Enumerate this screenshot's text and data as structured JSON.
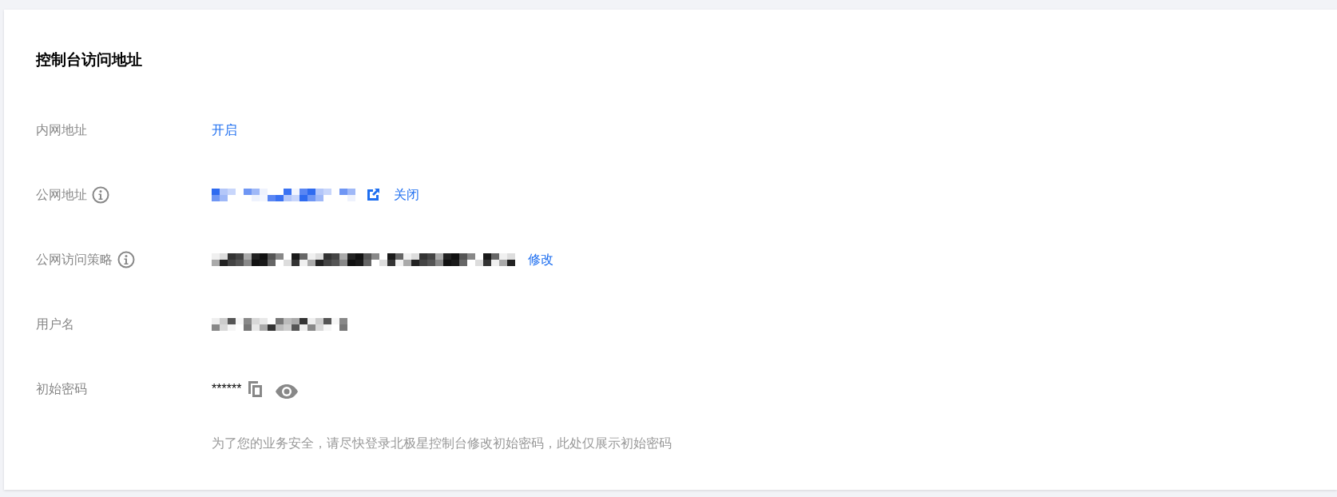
{
  "title": "控制台访问地址",
  "rows": [
    {
      "label": "内网地址",
      "info": false,
      "actions": [
        "开启"
      ]
    },
    {
      "label": "公网地址",
      "info": true,
      "redacted": true,
      "external_link": true,
      "actions": [
        "关闭"
      ]
    },
    {
      "label": "公网访问策略",
      "info": true,
      "redacted": true,
      "actions": [
        "修改"
      ]
    },
    {
      "label": "用户名",
      "info": false,
      "redacted": true
    },
    {
      "label": "初始密码",
      "info": false,
      "value": "******",
      "copy": true,
      "reveal": true,
      "hint": "为了您的业务安全，请尽快登录北极星控制台修改初始密码，此处仅展示初始密码"
    }
  ]
}
